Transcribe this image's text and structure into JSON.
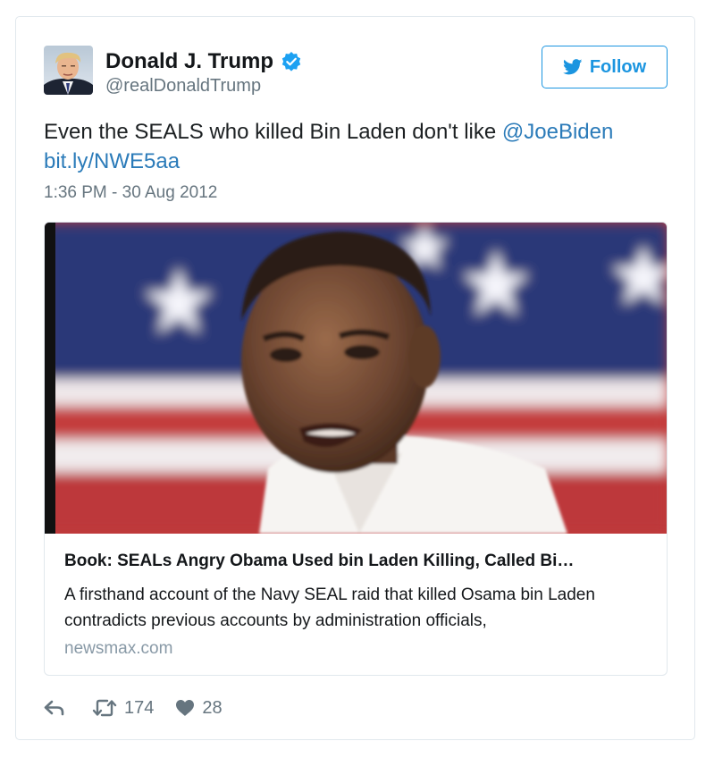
{
  "author": {
    "display_name": "Donald J. Trump",
    "screen_name": "@realDonaldTrump",
    "verified": true
  },
  "follow_button": {
    "label": "Follow"
  },
  "tweet": {
    "text_prefix": "Even the SEALS who killed Bin Laden don't like ",
    "mention": "@JoeBiden",
    "link": "bit.ly/NWE5aa",
    "timestamp": "1:36 PM - 30 Aug 2012"
  },
  "card": {
    "title": "Book: SEALs Angry Obama Used bin Laden Killing, Called Bi…",
    "description": "A firsthand account of the Navy SEAL raid that killed Osama bin Laden contradicts previous accounts by administration officials,",
    "domain": "newsmax.com"
  },
  "stats": {
    "retweets": "174",
    "likes": "28"
  },
  "icons": {
    "reply": "reply-icon",
    "retweet": "retweet-icon",
    "like": "heart-icon",
    "verified": "verified-badge-icon",
    "bird": "twitter-bird-icon"
  },
  "colors": {
    "link": "#2b7bb9",
    "follow_accent": "#1b95e0",
    "verified": "#1da1f2",
    "muted": "#66757f"
  }
}
